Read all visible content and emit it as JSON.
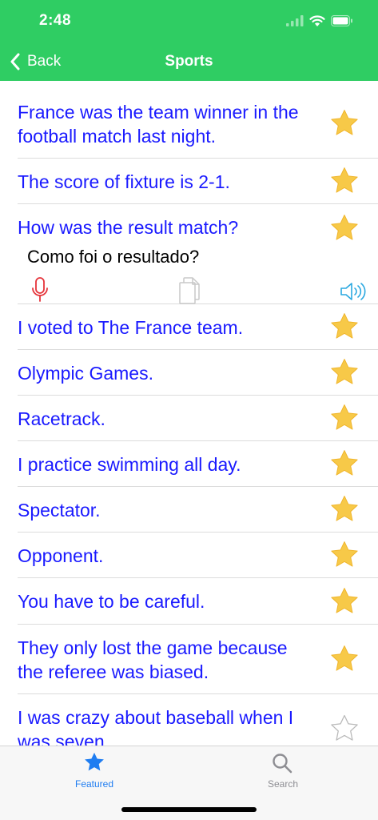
{
  "status_bar": {
    "time": "2:48"
  },
  "nav": {
    "back_label": "Back",
    "title": "Sports"
  },
  "rows": [
    {
      "line1": "France was the team winner in the",
      "line2": "football match last night.",
      "favorite": true
    },
    {
      "line1": "The score of fixture is 2-1.",
      "line2": "",
      "favorite": true
    },
    {
      "line1": "How was the result match?",
      "line2": "",
      "favorite": true,
      "expanded": true,
      "translation": "Como foi o resultado?"
    },
    {
      "line1": "I voted to The France team.",
      "line2": "",
      "favorite": true
    },
    {
      "line1": "Olympic Games.",
      "line2": "",
      "favorite": true
    },
    {
      "line1": "Racetrack.",
      "line2": "",
      "favorite": true
    },
    {
      "line1": "I practice swimming all day.",
      "line2": "",
      "favorite": true
    },
    {
      "line1": "Spectator.",
      "line2": "",
      "favorite": true
    },
    {
      "line1": "Opponent.",
      "line2": "",
      "favorite": true
    },
    {
      "line1": "You have to be careful.",
      "line2": "",
      "favorite": true
    },
    {
      "line1": "They only lost the game because",
      "line2": "the referee was biased.",
      "favorite": true
    },
    {
      "line1": "I was crazy about baseball when I",
      "line2": "was seven.",
      "favorite": false
    }
  ],
  "tabs": [
    {
      "label": "Featured",
      "icon": "star-icon",
      "active": true
    },
    {
      "label": "Search",
      "icon": "search-icon",
      "active": false
    }
  ],
  "colors": {
    "header": "#2fcd63",
    "sentence": "#1a1aff",
    "star_fill": "#f7c948",
    "mic": "#e5343b",
    "speaker": "#2aa8e0",
    "tab_active": "#1f7df1",
    "tab_inactive": "#8e8e93"
  }
}
